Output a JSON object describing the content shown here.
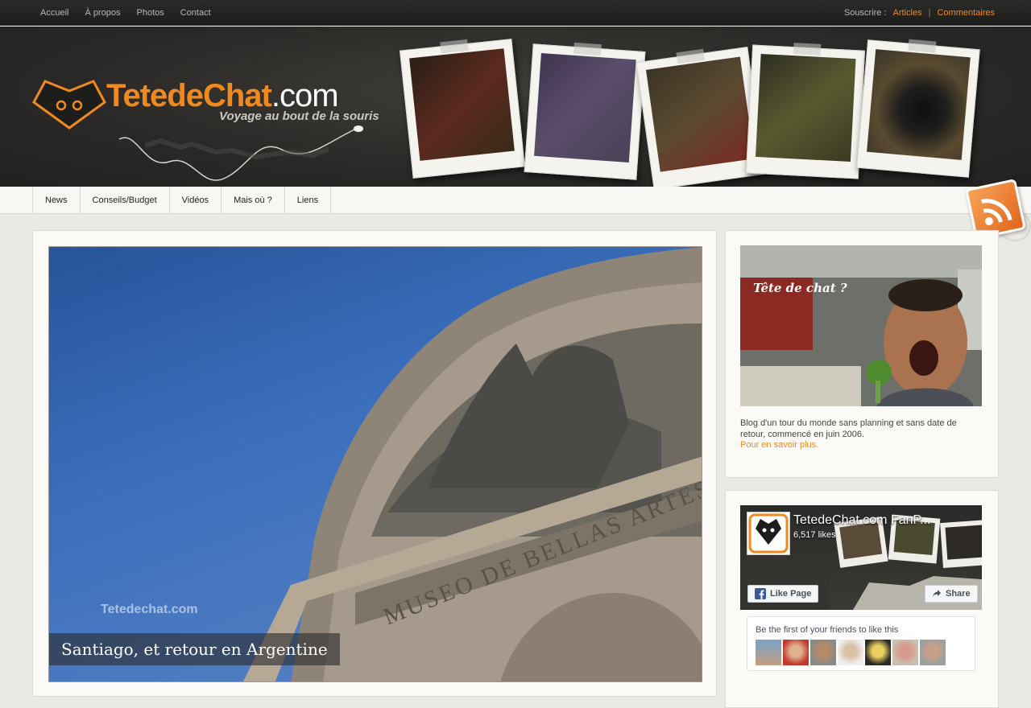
{
  "topnav": {
    "items": [
      "Accueil",
      "À propos",
      "Photos",
      "Contact"
    ],
    "subscribe_label": "Souscrire :",
    "subscribe_articles": "Articles",
    "subscribe_separator": "|",
    "subscribe_comments": "Commentaires"
  },
  "header": {
    "logo_name": "TetedeChat",
    "logo_tld": ".com",
    "tagline": "Voyage au bout de la souris"
  },
  "mainnav": {
    "items": [
      "News",
      "Conseils/Budget",
      "Vidéos",
      "Mais où ?",
      "Liens"
    ]
  },
  "feature": {
    "caption": "Santiago, et retour en Argentine",
    "watermark": "Tetedechat.com",
    "building_text": "MUSEO DE BELLAS ARTES"
  },
  "about": {
    "image_title": "Tête de chat ?",
    "text": "Blog d'un tour du monde sans planning et sans date de retour, commencé en juin 2006.",
    "more_link": "Pour en savoir plus."
  },
  "facebook": {
    "page_name": "TetedeChat.com FanP...",
    "likes": "6,517 likes",
    "like_button": "Like Page",
    "share_button": "Share",
    "friends_text": "Be the first of your friends to like this"
  },
  "colors": {
    "accent": "#f08a1e",
    "header_bg": "#2a2927",
    "page_bg": "#ebe9e3"
  }
}
